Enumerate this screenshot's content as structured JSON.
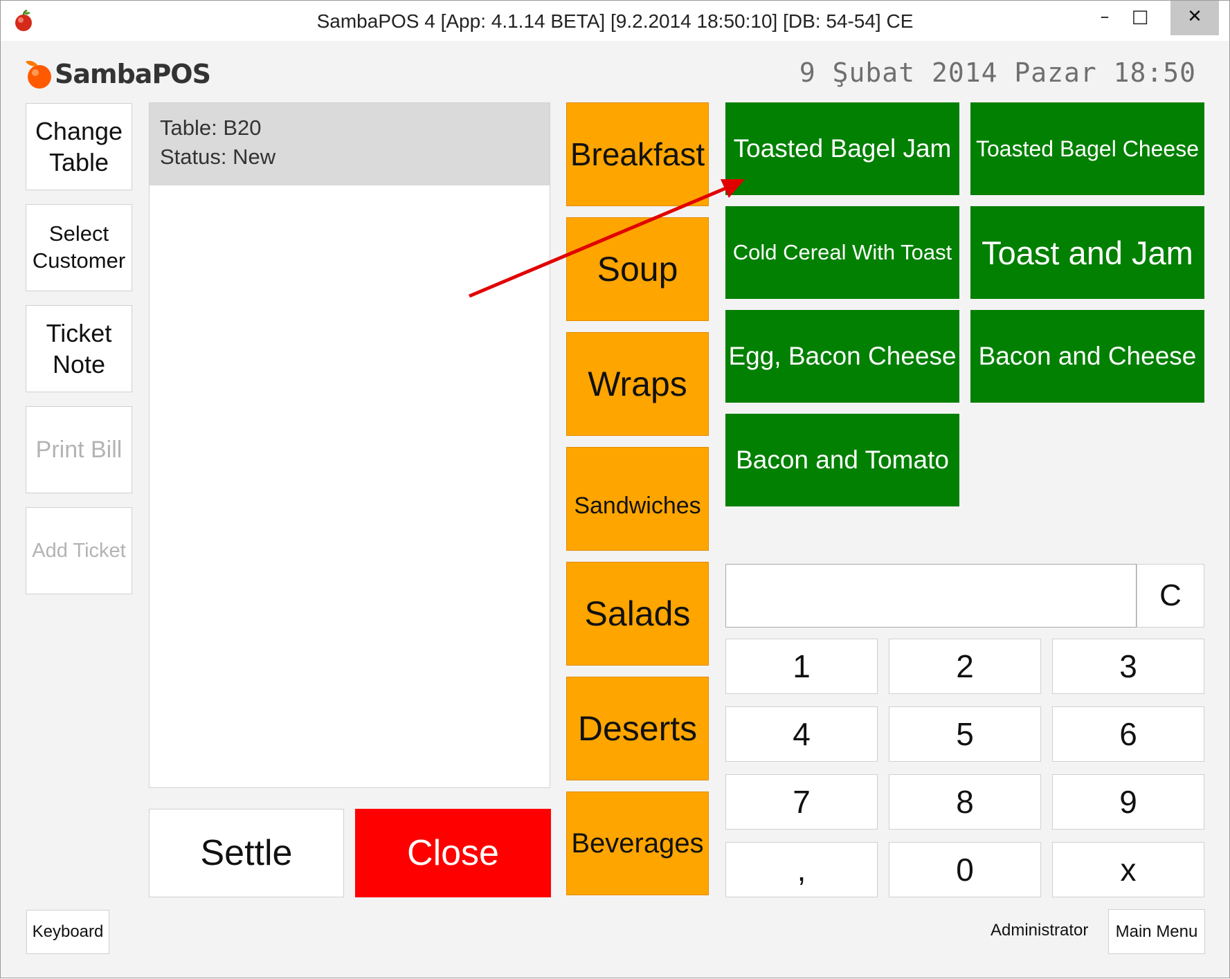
{
  "window": {
    "title": "SambaPOS 4 [App: 4.1.14 BETA] [9.2.2014 18:50:10] [DB: 54-54] CE",
    "minimize_glyph": "–",
    "maximize_glyph": "□",
    "close_glyph": "✕"
  },
  "header": {
    "logo_text": "SambaPOS",
    "datetime": "9 Şubat 2014 Pazar 18:50"
  },
  "sidebar": {
    "change_table": "Change Table",
    "select_customer": "Select Customer",
    "ticket_note": "Ticket Note",
    "print_bill": "Print Bill",
    "add_ticket": "Add Ticket"
  },
  "ticket": {
    "table": "Table: B20",
    "status": "Status: New"
  },
  "actions": {
    "settle": "Settle",
    "close": "Close"
  },
  "categories": [
    "Breakfast",
    "Soup",
    "Wraps",
    "Sandwiches",
    "Salads",
    "Deserts",
    "Beverages"
  ],
  "menu_items": [
    "Toasted Bagel Jam",
    "Toasted Bagel Cheese",
    "Cold Cereal With Toast",
    "Toast and Jam",
    "Egg, Bacon Cheese",
    "Bacon and Cheese",
    "Bacon and Tomato"
  ],
  "numpad": {
    "clear": "C",
    "keys": [
      "1",
      "2",
      "3",
      "4",
      "5",
      "6",
      "7",
      "8",
      "9",
      ",",
      "0",
      "x"
    ]
  },
  "footer": {
    "keyboard": "Keyboard",
    "user": "Administrator",
    "main_menu": "Main Menu"
  },
  "colors": {
    "category": "#ffa500",
    "menu_item": "#028002",
    "close_button": "#ff0000",
    "annotation_arrow": "#e00000"
  }
}
